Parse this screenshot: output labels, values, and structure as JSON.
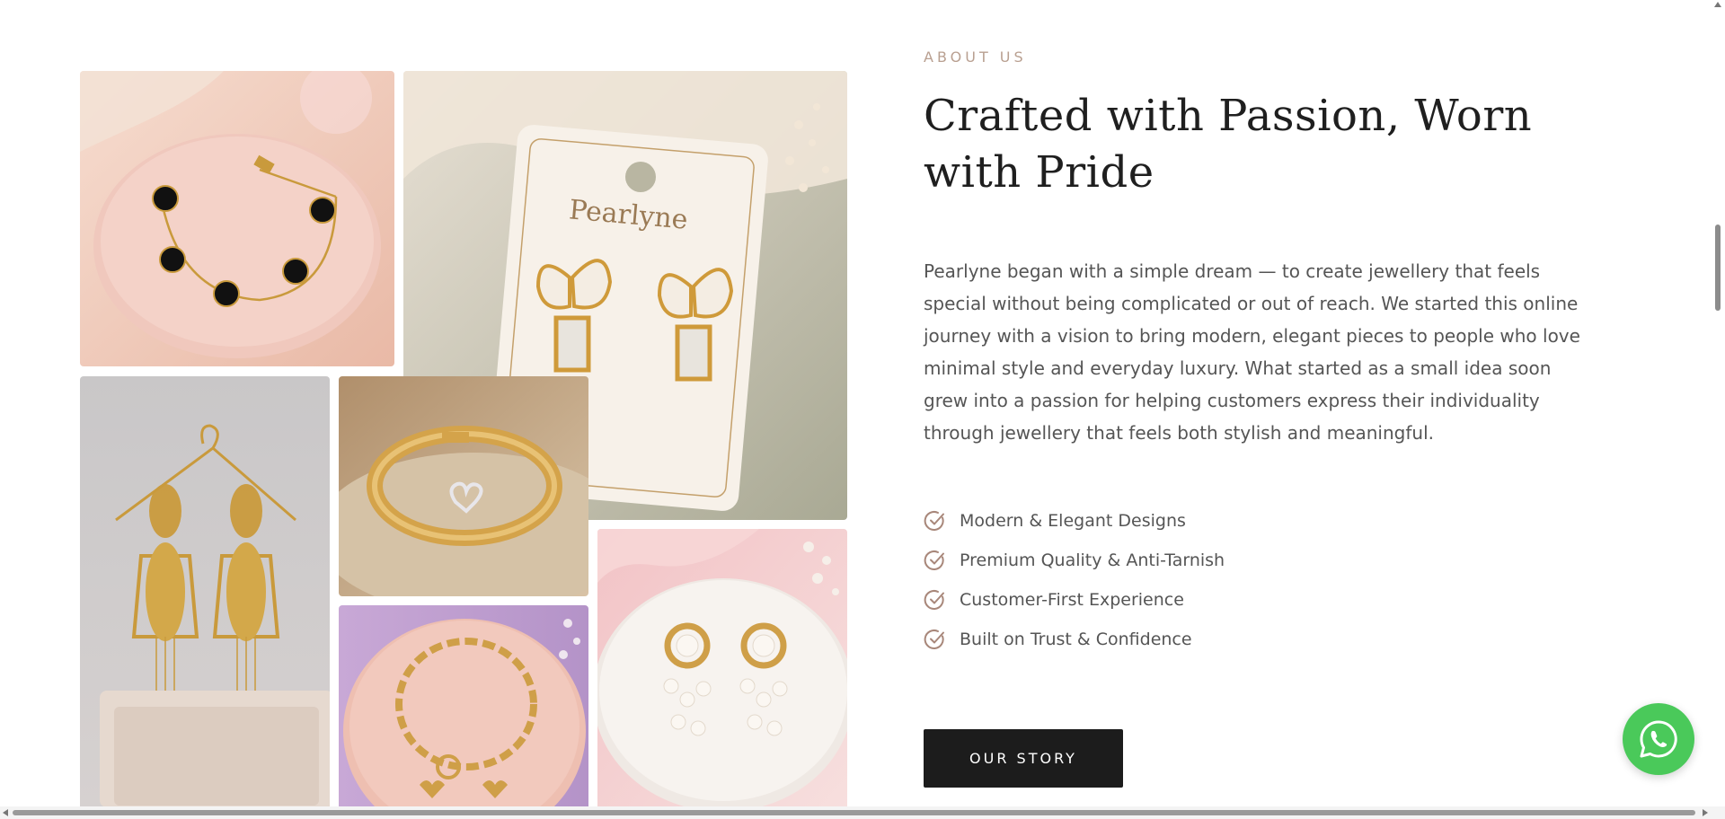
{
  "about": {
    "eyebrow": "ABOUT US",
    "heading": "Crafted with Passion, Worn with Pride",
    "paragraph": "Pearlyne began with a simple dream — to create jewellery that feels special without being complicated or out of reach. We started this online journey with a vision to bring modern, elegant pieces to people who love minimal style and everyday luxury. What started as a small idea soon grew into a passion for helping customers express their individuality through jewellery that feels both stylish and meaningful.",
    "features": [
      {
        "label": "Modern & Elegant Designs",
        "icon": "check-circle-icon"
      },
      {
        "label": "Premium Quality & Anti-Tarnish",
        "icon": "check-circle-icon"
      },
      {
        "label": "Customer-First Experience",
        "icon": "check-circle-icon"
      },
      {
        "label": "Built on Trust & Confidence",
        "icon": "check-circle-icon"
      }
    ],
    "cta_label": "OUR STORY"
  },
  "gallery": {
    "card_brand": "Pearlyne",
    "images": [
      {
        "name": "black-clover-bracelet-image"
      },
      {
        "name": "butterfly-earrings-image"
      },
      {
        "name": "leaf-drop-earrings-image"
      },
      {
        "name": "heart-bangle-image"
      },
      {
        "name": "chain-link-bracelet-image"
      },
      {
        "name": "pearl-cluster-earrings-image"
      }
    ]
  },
  "whatsapp": {
    "icon": "whatsapp-icon"
  },
  "colors": {
    "accent": "#b9a091",
    "heading": "#1f1f1f",
    "body_text": "#555555",
    "button_bg": "#1c1c1c",
    "whatsapp_green": "#4ac95a"
  }
}
